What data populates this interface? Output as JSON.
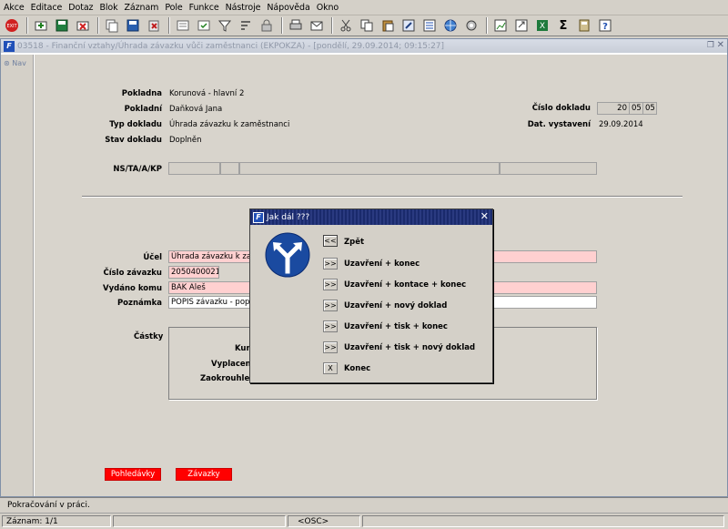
{
  "menu": [
    "Akce",
    "Editace",
    "Dotaz",
    "Blok",
    "Záznam",
    "Pole",
    "Funkce",
    "Nástroje",
    "Nápověda",
    "Okno"
  ],
  "window_title": "03518 - Finanční vztahy/Úhrada závazku vůči zaměstnanci (EKPOKZA) - [pondělí, 29.09.2014; 09:15:27]",
  "nav_label": "Nav",
  "header": {
    "pokladna_label": "Pokladna",
    "pokladna_value": "Korunová - hlavní 2",
    "pokladni_label": "Pokladní",
    "pokladni_value": "Daňková Jana",
    "typ_label": "Typ dokladu",
    "typ_value": "Úhrada závazku k zaměstnanci",
    "stav_label": "Stav dokladu",
    "stav_value": "Doplněn",
    "cislo_dokladu_label": "Číslo dokladu",
    "cislo_dokladu": [
      "20",
      "05",
      "05"
    ],
    "dat_vystaveni_label": "Dat. vystavení",
    "dat_vystaveni_value": "29.09.2014",
    "ns_label": "NS/TA/A/KP"
  },
  "detail": {
    "ucel_label": "Účel",
    "ucel_value": "Úhrada závazku k zam",
    "cislo_zavazku_label": "Číslo závazku",
    "cislo_zavazku_value": "2050400021",
    "vydano_label": "Vydáno komu",
    "vydano_value": "BAK Aleš",
    "poznamka_label": "Poznámka",
    "poznamka_value": "POPIS závazku - popis",
    "castky_label": "Částky",
    "kurz_label": "Kurz",
    "vyplaceno_label": "Vyplaceno",
    "zaokrouhleni_label": "Zaokrouhlen"
  },
  "buttons": {
    "pohledavky": "Pohledávky",
    "zavazky": "Závazky"
  },
  "dialog": {
    "title": "Jak dál ???",
    "options": [
      {
        "btn": "<<",
        "label": "Zpět"
      },
      {
        "btn": ">>",
        "label": "Uzavření + konec"
      },
      {
        "btn": ">>",
        "label": "Uzavření + kontace + konec"
      },
      {
        "btn": ">>",
        "label": "Uzavření + nový doklad"
      },
      {
        "btn": ">>",
        "label": "Uzavření + tisk + konec"
      },
      {
        "btn": ">>",
        "label": "Uzavření + tisk + nový doklad"
      },
      {
        "btn": "X",
        "label": "Konec"
      }
    ]
  },
  "status": {
    "message": "Pokračování v práci.",
    "record": "Záznam: 1/1",
    "osc": "<OSC>"
  },
  "colors": {
    "required_field": "#ffd0d0",
    "action_button": "#ff0000",
    "dialog_title": "#1a2a6c"
  }
}
